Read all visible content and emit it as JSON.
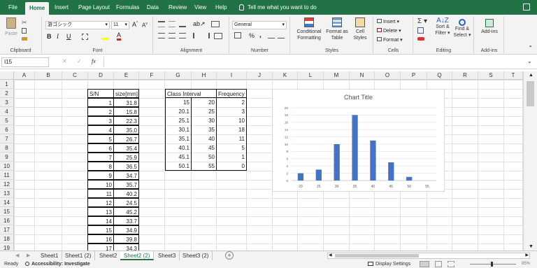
{
  "ribbon_tabs": [
    "File",
    "Home",
    "Insert",
    "Page Layout",
    "Formulas",
    "Data",
    "Review",
    "View",
    "Help"
  ],
  "tell_me": "Tell me what you want to do",
  "clipboard": {
    "paste": "Paste",
    "label": "Clipboard"
  },
  "font": {
    "name": "游ゴシック",
    "size": "11",
    "label": "Font",
    "bold": "B",
    "italic": "I",
    "underline": "U"
  },
  "alignment": {
    "label": "Alignment"
  },
  "number": {
    "format": "General",
    "label": "Number",
    "percent": "%",
    "comma": ","
  },
  "styles": {
    "conditional": "Conditional",
    "formatting": "Formatting",
    "format_as": "Format as",
    "table": "Table",
    "cell": "Cell",
    "cell_styles": "Styles",
    "label": "Styles"
  },
  "cells": {
    "insert": "Insert",
    "delete": "Delete",
    "format": "Format",
    "label": "Cells"
  },
  "editing": {
    "sort": "Sort &",
    "filter": "Filter",
    "find": "Find &",
    "select": "Select",
    "label": "Editing"
  },
  "addins": {
    "btn": "Add-ins",
    "label": "Add-ins"
  },
  "formula_bar": {
    "name_box": "I15",
    "fx": "fx",
    "content": ""
  },
  "columns": [
    "A",
    "B",
    "C",
    "D",
    "E",
    "F",
    "G",
    "H",
    "I",
    "J",
    "K",
    "L",
    "M",
    "N",
    "O",
    "P",
    "Q",
    "R",
    "S",
    "T"
  ],
  "rows": [
    "1",
    "2",
    "3",
    "4",
    "5",
    "6",
    "7",
    "8",
    "9",
    "10",
    "11",
    "12",
    "13",
    "14",
    "15",
    "16",
    "17",
    "18",
    "19"
  ],
  "table1": {
    "header_sn": "S/N",
    "header_size": "size[mm]",
    "rows": [
      [
        "1",
        "31.8"
      ],
      [
        "2",
        "15.8"
      ],
      [
        "3",
        "22.3"
      ],
      [
        "4",
        "35.0"
      ],
      [
        "5",
        "26.7"
      ],
      [
        "6",
        "35.4"
      ],
      [
        "7",
        "25.9"
      ],
      [
        "8",
        "36.5"
      ],
      [
        "9",
        "34.7"
      ],
      [
        "10",
        "35.7"
      ],
      [
        "11",
        "40.2"
      ],
      [
        "12",
        "24.5"
      ],
      [
        "13",
        "45.2"
      ],
      [
        "14",
        "33.7"
      ],
      [
        "15",
        "34.9"
      ],
      [
        "16",
        "39.8"
      ],
      [
        "17",
        "34.3"
      ]
    ]
  },
  "table2": {
    "header_interval": "Class Interval",
    "header_freq": "Frequency",
    "rows": [
      [
        "15",
        "20",
        "2"
      ],
      [
        "20.1",
        "25",
        "3"
      ],
      [
        "25.1",
        "30",
        "10"
      ],
      [
        "30.1",
        "35",
        "18"
      ],
      [
        "35.1",
        "40",
        "11"
      ],
      [
        "40.1",
        "45",
        "5"
      ],
      [
        "45.1",
        "50",
        "1"
      ],
      [
        "50.1",
        "55",
        "0"
      ]
    ]
  },
  "chart_data": {
    "type": "bar",
    "title": "Chart Title",
    "categories": [
      "20",
      "25",
      "30",
      "35",
      "40",
      "45",
      "50",
      "55"
    ],
    "values": [
      2,
      3,
      10,
      18,
      11,
      5,
      1,
      0
    ],
    "ylim": [
      0,
      20
    ],
    "yticks": [
      "0",
      "2",
      "4",
      "6",
      "8",
      "10",
      "12",
      "14",
      "16",
      "18",
      "20"
    ],
    "grid": true,
    "bar_color": "#4472c4"
  },
  "sheets": [
    "Sheet1",
    "Sheet1 (2)",
    "Sheet2",
    "Sheet2 (2)",
    "Sheet3",
    "Sheet3 (2)"
  ],
  "active_sheet": "Sheet2 (2)",
  "status": {
    "ready": "Ready",
    "accessibility": "Accessibility: Investigate",
    "display": "Display Settings",
    "zoom": "85%"
  },
  "colors": {
    "excel_green": "#217346"
  }
}
